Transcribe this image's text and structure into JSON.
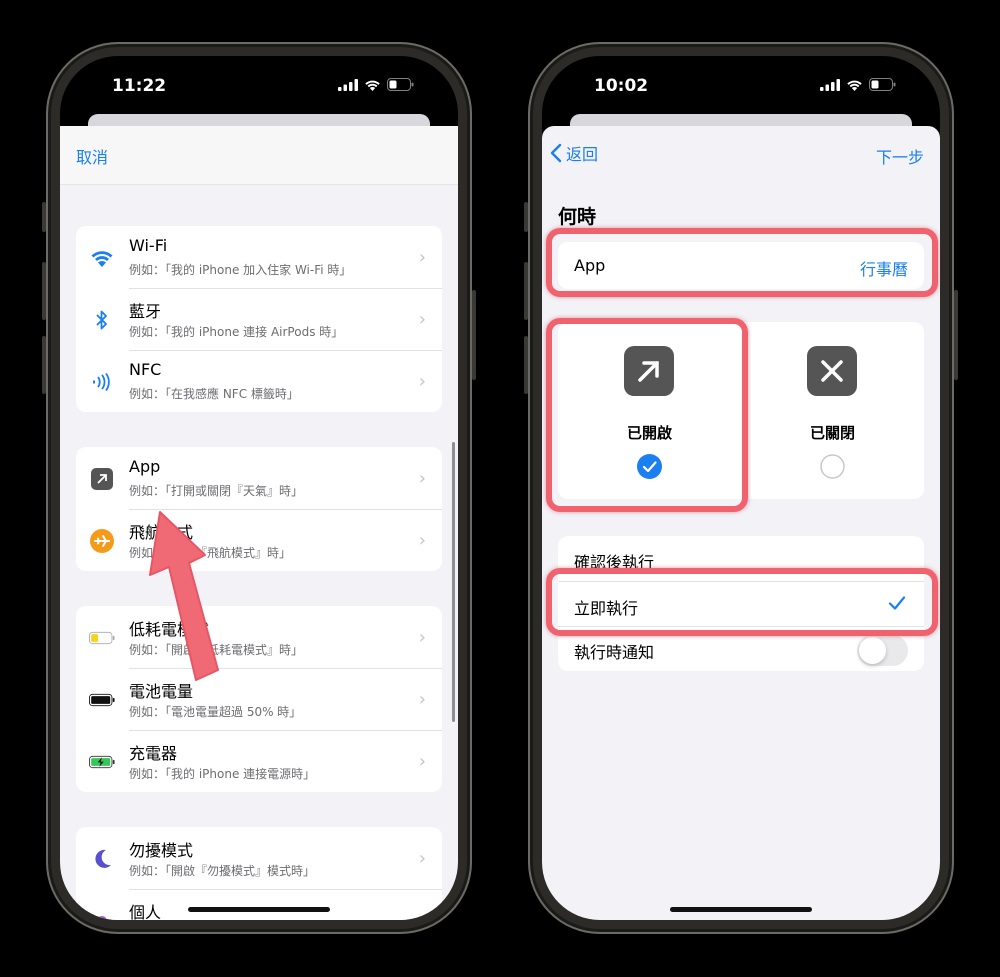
{
  "left": {
    "time": "11:22",
    "cancel": "取消",
    "group1": [
      {
        "title": "Wi-Fi",
        "sub": "例如：「我的 iPhone 加入住家 Wi-Fi 時」"
      },
      {
        "title": "藍牙",
        "sub": "例如：「我的 iPhone 連接 AirPods 時」"
      },
      {
        "title": "NFC",
        "sub": "例如：「在我感應 NFC 標籤時」"
      }
    ],
    "group2": [
      {
        "title": "App",
        "sub": "例如：「打開或關閉『天氣』時」"
      },
      {
        "title": "飛航模式",
        "sub": "例如：「開啟『飛航模式』時」"
      }
    ],
    "group3": [
      {
        "title": "低耗電模式",
        "sub": "例如：「開啟『低耗電模式』時」"
      },
      {
        "title": "電池電量",
        "sub": "例如：「電池電量超過 50% 時」"
      },
      {
        "title": "充電器",
        "sub": "例如：「我的 iPhone 連接電源時」"
      }
    ],
    "group4": [
      {
        "title": "勿擾模式",
        "sub": "例如：「開啟『勿擾模式』模式時」"
      },
      {
        "title": "個人",
        "sub": ""
      }
    ]
  },
  "right": {
    "time": "10:02",
    "back": "返回",
    "next": "下一步",
    "section_title": "何時",
    "app_label": "App",
    "app_value": "行事曆",
    "opened": "已開啟",
    "closed": "已關閉",
    "options": [
      "確認後執行",
      "立即執行"
    ],
    "notify_label": "執行時通知"
  },
  "colors": {
    "accent": "#1a7ff0",
    "highlight": "#f0626d",
    "arrow": "#f06a76"
  }
}
